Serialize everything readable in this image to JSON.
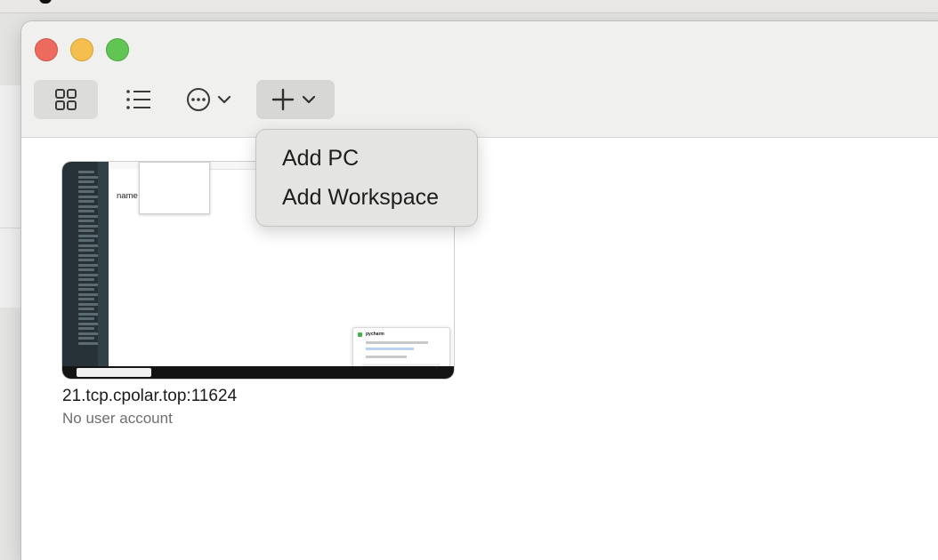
{
  "toolbar": {
    "view_grid_icon": "grid-icon",
    "view_list_icon": "list-icon",
    "more_icon": "ellipsis-circle-icon",
    "add_icon": "plus-icon",
    "chevron_icon": "chevron-down-icon"
  },
  "pc": {
    "name": "21.tcp.cpolar.top:11624",
    "subtitle": "No user account",
    "thumbnail_name_label": "name"
  },
  "add_menu": {
    "items": [
      "Add PC",
      "Add Workspace"
    ]
  }
}
